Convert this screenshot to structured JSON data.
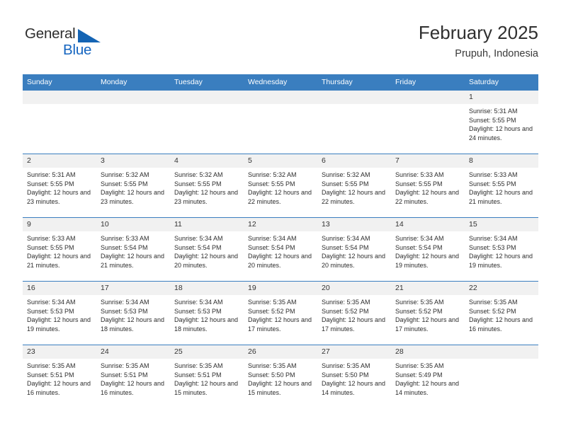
{
  "logo": {
    "word_one": "General",
    "word_two": "Blue",
    "triangle_icon": "triangle-icon",
    "brand_blue": "#1565c0",
    "brand_dark": "#2e2e2e"
  },
  "header": {
    "title": "February 2025",
    "subtitle": "Prupuh, Indonesia"
  },
  "theme": {
    "header_blue": "#3a7ebf",
    "daynum_band": "#f1f1f1",
    "text": "#2d2d2d"
  },
  "weekdays": [
    "Sunday",
    "Monday",
    "Tuesday",
    "Wednesday",
    "Thursday",
    "Friday",
    "Saturday"
  ],
  "labels": {
    "sunrise_prefix": "Sunrise:",
    "sunset_prefix": "Sunset:",
    "daylight_prefix": "Daylight:"
  },
  "weeks": [
    [
      {
        "day": "",
        "empty": true
      },
      {
        "day": "",
        "empty": true
      },
      {
        "day": "",
        "empty": true
      },
      {
        "day": "",
        "empty": true
      },
      {
        "day": "",
        "empty": true
      },
      {
        "day": "",
        "empty": true
      },
      {
        "day": "1",
        "sunrise": "Sunrise: 5:31 AM",
        "sunset": "Sunset: 5:55 PM",
        "daylight": "Daylight: 12 hours and 24 minutes."
      }
    ],
    [
      {
        "day": "2",
        "sunrise": "Sunrise: 5:31 AM",
        "sunset": "Sunset: 5:55 PM",
        "daylight": "Daylight: 12 hours and 23 minutes."
      },
      {
        "day": "3",
        "sunrise": "Sunrise: 5:32 AM",
        "sunset": "Sunset: 5:55 PM",
        "daylight": "Daylight: 12 hours and 23 minutes."
      },
      {
        "day": "4",
        "sunrise": "Sunrise: 5:32 AM",
        "sunset": "Sunset: 5:55 PM",
        "daylight": "Daylight: 12 hours and 23 minutes."
      },
      {
        "day": "5",
        "sunrise": "Sunrise: 5:32 AM",
        "sunset": "Sunset: 5:55 PM",
        "daylight": "Daylight: 12 hours and 22 minutes."
      },
      {
        "day": "6",
        "sunrise": "Sunrise: 5:32 AM",
        "sunset": "Sunset: 5:55 PM",
        "daylight": "Daylight: 12 hours and 22 minutes."
      },
      {
        "day": "7",
        "sunrise": "Sunrise: 5:33 AM",
        "sunset": "Sunset: 5:55 PM",
        "daylight": "Daylight: 12 hours and 22 minutes."
      },
      {
        "day": "8",
        "sunrise": "Sunrise: 5:33 AM",
        "sunset": "Sunset: 5:55 PM",
        "daylight": "Daylight: 12 hours and 21 minutes."
      }
    ],
    [
      {
        "day": "9",
        "sunrise": "Sunrise: 5:33 AM",
        "sunset": "Sunset: 5:55 PM",
        "daylight": "Daylight: 12 hours and 21 minutes."
      },
      {
        "day": "10",
        "sunrise": "Sunrise: 5:33 AM",
        "sunset": "Sunset: 5:54 PM",
        "daylight": "Daylight: 12 hours and 21 minutes."
      },
      {
        "day": "11",
        "sunrise": "Sunrise: 5:34 AM",
        "sunset": "Sunset: 5:54 PM",
        "daylight": "Daylight: 12 hours and 20 minutes."
      },
      {
        "day": "12",
        "sunrise": "Sunrise: 5:34 AM",
        "sunset": "Sunset: 5:54 PM",
        "daylight": "Daylight: 12 hours and 20 minutes."
      },
      {
        "day": "13",
        "sunrise": "Sunrise: 5:34 AM",
        "sunset": "Sunset: 5:54 PM",
        "daylight": "Daylight: 12 hours and 20 minutes."
      },
      {
        "day": "14",
        "sunrise": "Sunrise: 5:34 AM",
        "sunset": "Sunset: 5:54 PM",
        "daylight": "Daylight: 12 hours and 19 minutes."
      },
      {
        "day": "15",
        "sunrise": "Sunrise: 5:34 AM",
        "sunset": "Sunset: 5:53 PM",
        "daylight": "Daylight: 12 hours and 19 minutes."
      }
    ],
    [
      {
        "day": "16",
        "sunrise": "Sunrise: 5:34 AM",
        "sunset": "Sunset: 5:53 PM",
        "daylight": "Daylight: 12 hours and 19 minutes."
      },
      {
        "day": "17",
        "sunrise": "Sunrise: 5:34 AM",
        "sunset": "Sunset: 5:53 PM",
        "daylight": "Daylight: 12 hours and 18 minutes."
      },
      {
        "day": "18",
        "sunrise": "Sunrise: 5:34 AM",
        "sunset": "Sunset: 5:53 PM",
        "daylight": "Daylight: 12 hours and 18 minutes."
      },
      {
        "day": "19",
        "sunrise": "Sunrise: 5:35 AM",
        "sunset": "Sunset: 5:52 PM",
        "daylight": "Daylight: 12 hours and 17 minutes."
      },
      {
        "day": "20",
        "sunrise": "Sunrise: 5:35 AM",
        "sunset": "Sunset: 5:52 PM",
        "daylight": "Daylight: 12 hours and 17 minutes."
      },
      {
        "day": "21",
        "sunrise": "Sunrise: 5:35 AM",
        "sunset": "Sunset: 5:52 PM",
        "daylight": "Daylight: 12 hours and 17 minutes."
      },
      {
        "day": "22",
        "sunrise": "Sunrise: 5:35 AM",
        "sunset": "Sunset: 5:52 PM",
        "daylight": "Daylight: 12 hours and 16 minutes."
      }
    ],
    [
      {
        "day": "23",
        "sunrise": "Sunrise: 5:35 AM",
        "sunset": "Sunset: 5:51 PM",
        "daylight": "Daylight: 12 hours and 16 minutes."
      },
      {
        "day": "24",
        "sunrise": "Sunrise: 5:35 AM",
        "sunset": "Sunset: 5:51 PM",
        "daylight": "Daylight: 12 hours and 16 minutes."
      },
      {
        "day": "25",
        "sunrise": "Sunrise: 5:35 AM",
        "sunset": "Sunset: 5:51 PM",
        "daylight": "Daylight: 12 hours and 15 minutes."
      },
      {
        "day": "26",
        "sunrise": "Sunrise: 5:35 AM",
        "sunset": "Sunset: 5:50 PM",
        "daylight": "Daylight: 12 hours and 15 minutes."
      },
      {
        "day": "27",
        "sunrise": "Sunrise: 5:35 AM",
        "sunset": "Sunset: 5:50 PM",
        "daylight": "Daylight: 12 hours and 14 minutes."
      },
      {
        "day": "28",
        "sunrise": "Sunrise: 5:35 AM",
        "sunset": "Sunset: 5:49 PM",
        "daylight": "Daylight: 12 hours and 14 minutes."
      },
      {
        "day": "",
        "empty": true
      }
    ]
  ]
}
